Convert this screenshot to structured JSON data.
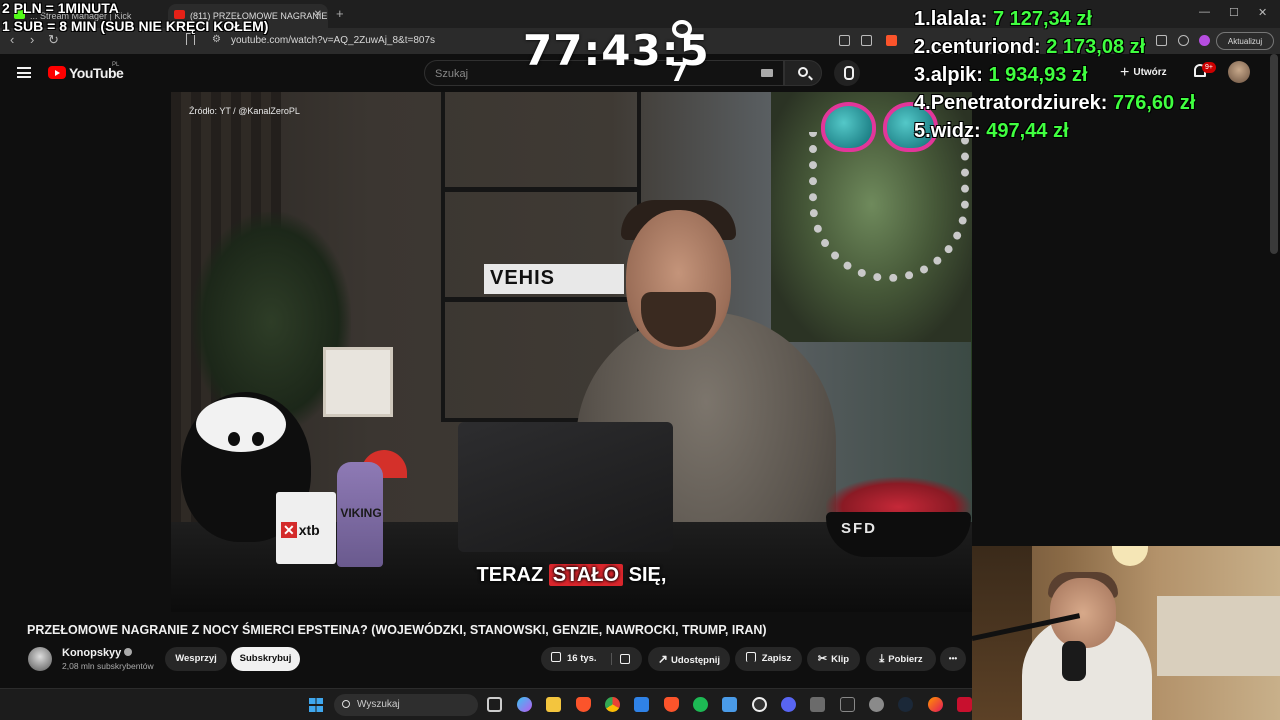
{
  "browser": {
    "tabs": [
      {
        "label": "... Stream Manager | Kick",
        "active": false
      },
      {
        "label": "(811) PRZEŁOMOWE NAGRANIE",
        "active": true
      }
    ],
    "new_tab_label": "+",
    "url": "youtube.com/watch?v=AQ_2ZuwAj_8&t=807s",
    "update_button": "Aktualizuj",
    "window_controls": {
      "minimize": "—",
      "maximize": "☐",
      "close": "✕"
    }
  },
  "youtube": {
    "logo_text": "YouTube",
    "country_code": "PL",
    "search_placeholder": "Szukaj",
    "create_label": "Utwórz",
    "notifications_count": "9+",
    "video": {
      "source_label": "Źródło: YT / @KanalZeroPL",
      "scene_text": {
        "shelf_sign": "VEHIS",
        "mug": "xtb",
        "bottle": "VIKING",
        "bowl": "SFD"
      },
      "subtitle_highlight": "STAŁO",
      "subtitle_before": "TERAZ",
      "subtitle_after": "SIĘ,"
    },
    "title": "PRZEŁOMOWE NAGRANIE Z NOCY ŚMIERCI EPSTEINA? (WOJEWÓDZKI, STANOWSKI, GENZIE, NAWROCKI, TRUMP, IRAN)",
    "channel": {
      "name": "Konopskyy",
      "subscribers": "2,08 mln subskrybentów"
    },
    "buttons": {
      "support": "Wesprzyj",
      "subscribe": "Subskrybuj",
      "likes": "16 tys.",
      "share": "Udostępnij",
      "save": "Zapisz",
      "clip": "Klip",
      "download": "Pobierz",
      "more": "•••"
    }
  },
  "overlay": {
    "rate_line_1": "2 PLN =  1MINUTA",
    "rate_line_2": "1 SUB = 8 MIN (SUB NIE KRĘCI KOŁEM)",
    "timer": "77:43:5",
    "timer_corner_digit": "7",
    "leaderboard": [
      {
        "rank": "1.",
        "name": "lalala:",
        "amount": "7 127,34 zł"
      },
      {
        "rank": "2.",
        "name": "centuriond:",
        "amount": "2 173,08 zł"
      },
      {
        "rank": "3.",
        "name": "alpik:",
        "amount": "1 934,93 zł"
      },
      {
        "rank": "4.",
        "name": "Penetratordziurek:",
        "amount": "776,60 zł"
      },
      {
        "rank": "5.",
        "name": "widz:",
        "amount": "497,44 zł"
      }
    ]
  },
  "taskbar": {
    "search_placeholder": "Wyszukaj",
    "icons": [
      "task-view-icon",
      "copilot-icon",
      "explorer-icon",
      "brave-icon",
      "chrome-icon",
      "store-icon",
      "brave-alt-icon",
      "spotify-icon",
      "notes-icon",
      "obs-icon",
      "discord-icon",
      "calculator-icon",
      "app-icon",
      "settings-icon",
      "steam-icon",
      "firefox-icon",
      "app-red-icon"
    ]
  },
  "colors": {
    "youtube_red": "#ff0000",
    "leaderboard_amount": "#40ff40",
    "subtitle_highlight": "#d9262c",
    "background": "#0f0f0f"
  }
}
